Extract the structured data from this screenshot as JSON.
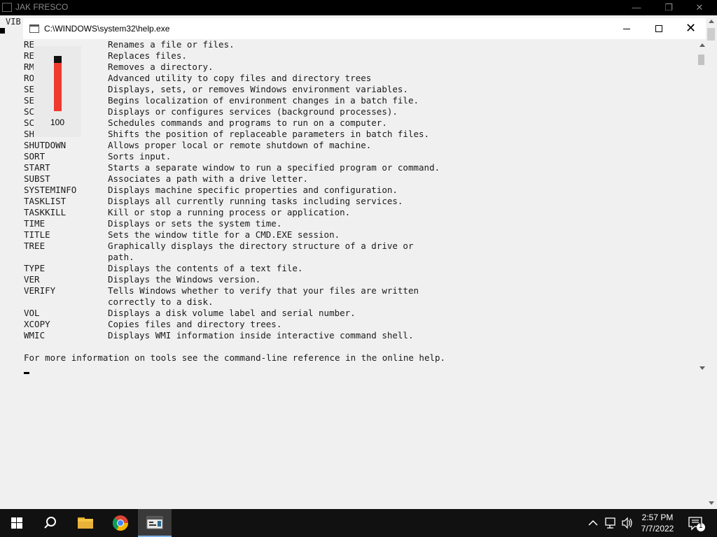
{
  "background_window": {
    "title": "JAK FRESCO",
    "text_fragment": "VIB",
    "min_label": "—",
    "restore_label": "❐",
    "close_label": "✕"
  },
  "console_window": {
    "title": "C:\\WINDOWS\\system32\\help.exe",
    "lines": [
      {
        "cmd": "RE",
        "desc": "Renames a file or files."
      },
      {
        "cmd": "RE",
        "desc": "Replaces files."
      },
      {
        "cmd": "RM",
        "desc": "Removes a directory."
      },
      {
        "cmd": "RO",
        "desc": "Advanced utility to copy files and directory trees"
      },
      {
        "cmd": "SE",
        "desc": "Displays, sets, or removes Windows environment variables."
      },
      {
        "cmd": "SE",
        "desc": "Begins localization of environment changes in a batch file."
      },
      {
        "cmd": "SC",
        "desc": "Displays or configures services (background processes)."
      },
      {
        "cmd": "SC",
        "desc": "Schedules commands and programs to run on a computer."
      },
      {
        "cmd": "SH",
        "desc": "Shifts the position of replaceable parameters in batch files."
      },
      {
        "cmd": "SHUTDOWN",
        "desc": "Allows proper local or remote shutdown of machine."
      },
      {
        "cmd": "SORT",
        "desc": "Sorts input."
      },
      {
        "cmd": "START",
        "desc": "Starts a separate window to run a specified program or command."
      },
      {
        "cmd": "SUBST",
        "desc": "Associates a path with a drive letter."
      },
      {
        "cmd": "SYSTEMINFO",
        "desc": "Displays machine specific properties and configuration."
      },
      {
        "cmd": "TASKLIST",
        "desc": "Displays all currently running tasks including services."
      },
      {
        "cmd": "TASKKILL",
        "desc": "Kill or stop a running process or application."
      },
      {
        "cmd": "TIME",
        "desc": "Displays or sets the system time."
      },
      {
        "cmd": "TITLE",
        "desc": "Sets the window title for a CMD.EXE session."
      },
      {
        "cmd": "TREE",
        "desc": "Graphically displays the directory structure of a drive or"
      },
      {
        "cmd": "",
        "desc": "path."
      },
      {
        "cmd": "TYPE",
        "desc": "Displays the contents of a text file."
      },
      {
        "cmd": "VER",
        "desc": "Displays the Windows version."
      },
      {
        "cmd": "VERIFY",
        "desc": "Tells Windows whether to verify that your files are written"
      },
      {
        "cmd": "",
        "desc": "correctly to a disk."
      },
      {
        "cmd": "VOL",
        "desc": "Displays a disk volume label and serial number."
      },
      {
        "cmd": "XCOPY",
        "desc": "Copies files and directory trees."
      },
      {
        "cmd": "WMIC",
        "desc": "Displays WMI information inside interactive command shell."
      }
    ],
    "footer": "For more information on tools see the command-line reference in the online help."
  },
  "gauge": {
    "value_label": "100",
    "fill_color": "#ef3a2f"
  },
  "taskbar": {
    "apps": [
      {
        "name": "start",
        "icon": "windows-logo-icon"
      },
      {
        "name": "search",
        "icon": "search-icon"
      },
      {
        "name": "file-explorer",
        "icon": "folder-icon"
      },
      {
        "name": "chrome",
        "icon": "chrome-icon"
      },
      {
        "name": "console",
        "icon": "console-icon",
        "active": true
      }
    ],
    "clock_time": "2:57 PM",
    "clock_date": "7/7/2022",
    "notification_count": "1"
  }
}
